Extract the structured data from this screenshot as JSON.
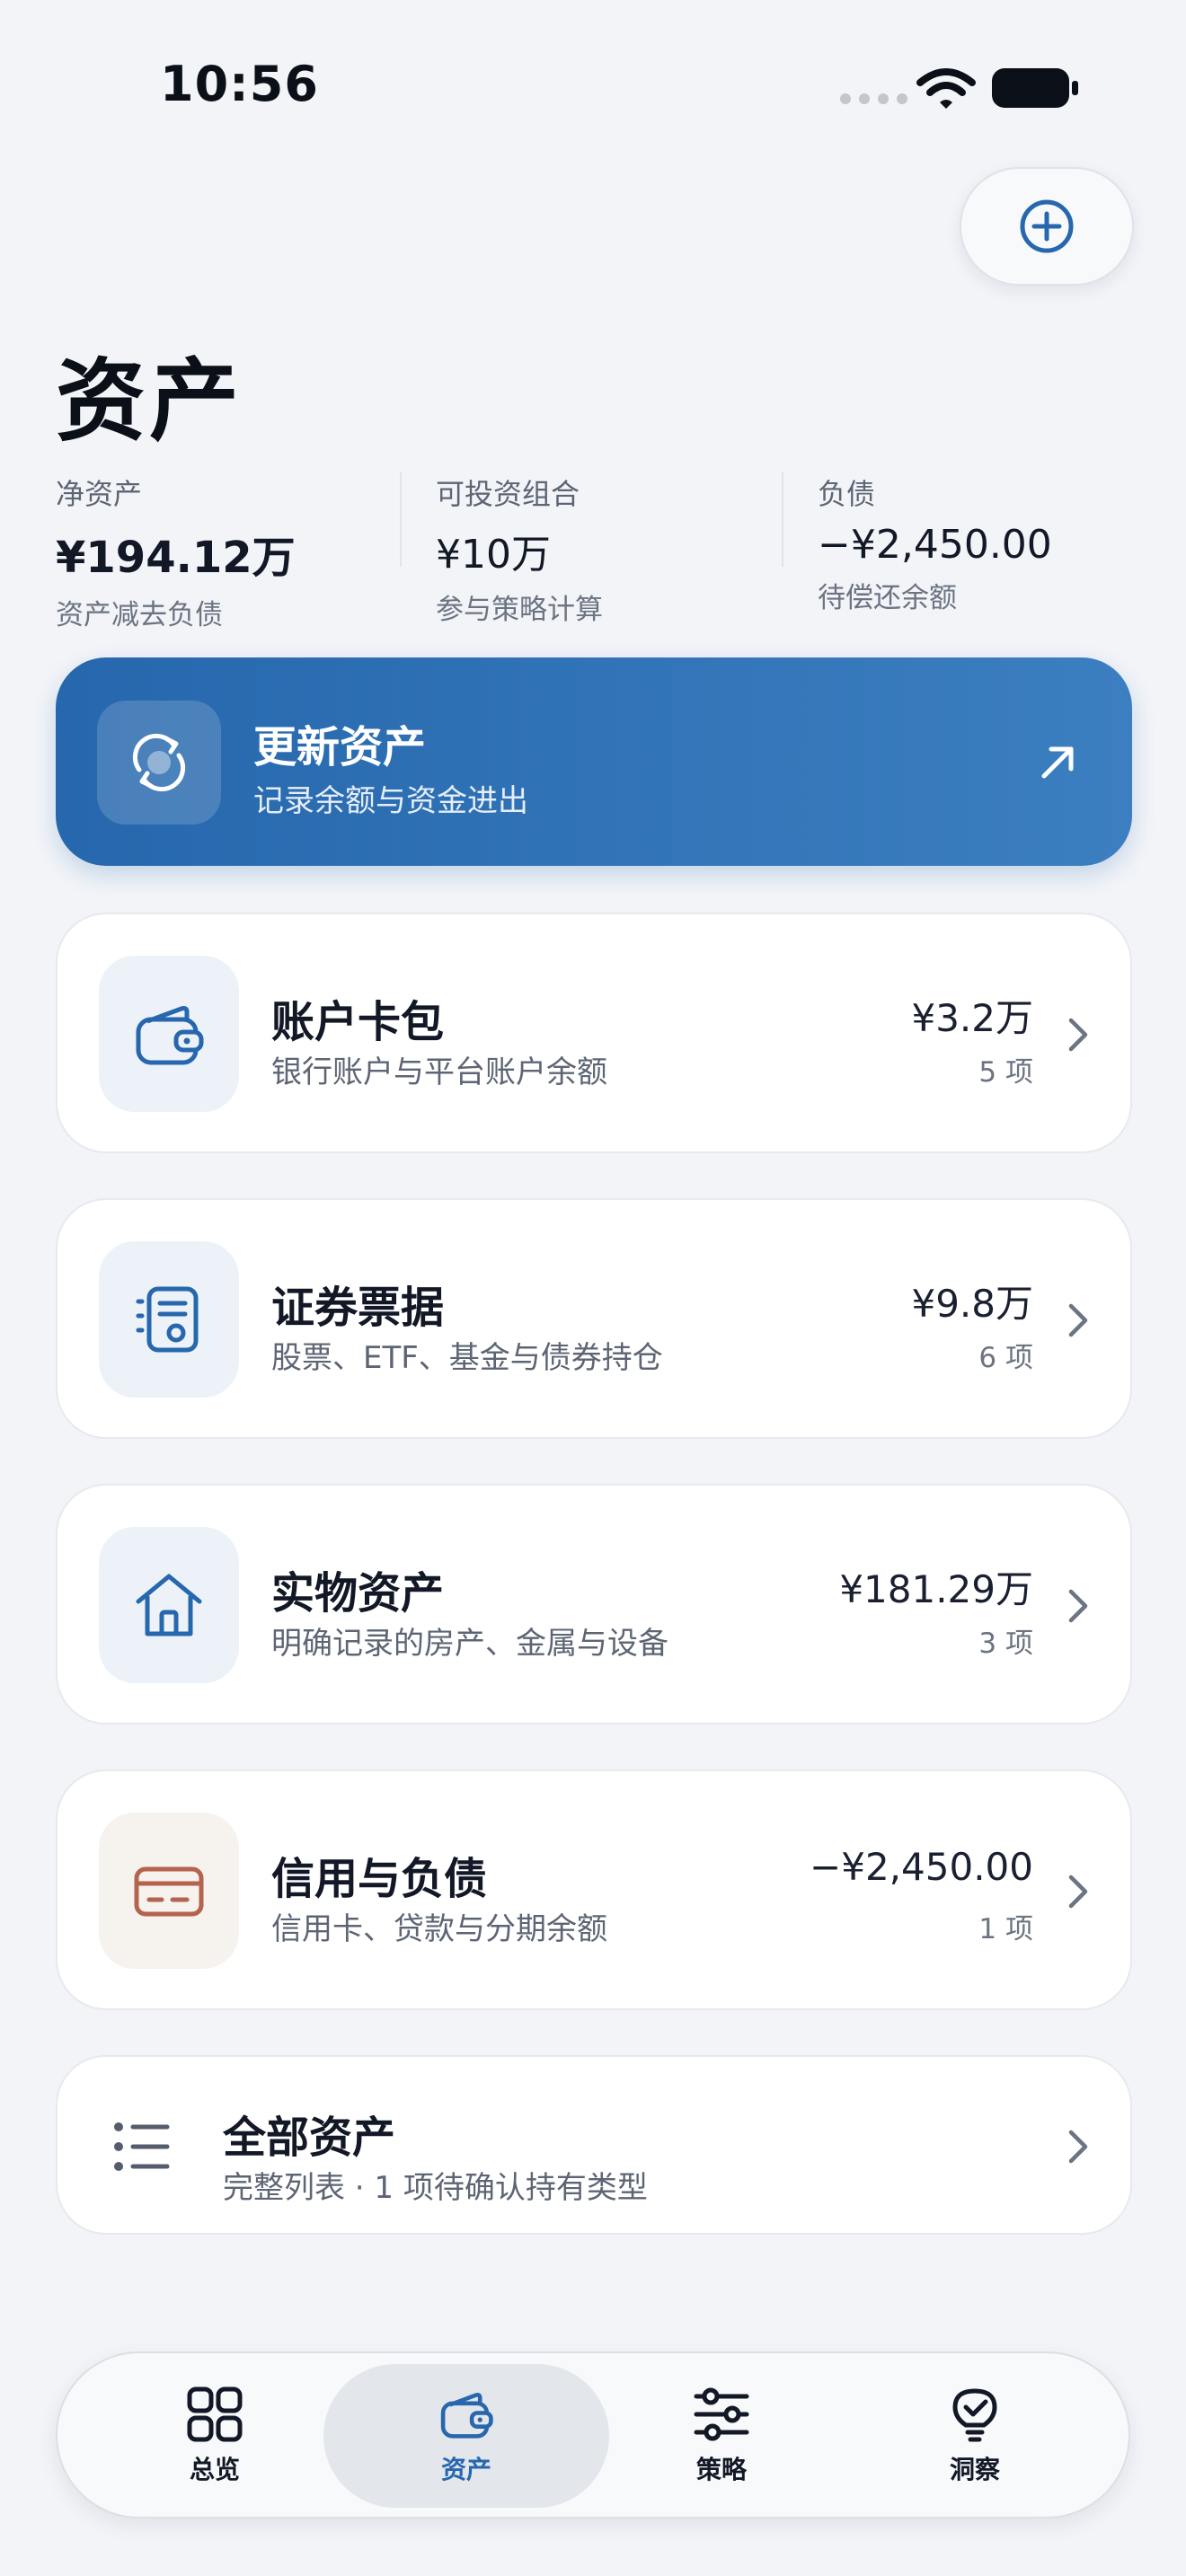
{
  "status": {
    "time": "10:56"
  },
  "page": {
    "title": "资产"
  },
  "summary": {
    "net": {
      "label": "净资产",
      "value": "¥194.12万",
      "sub": "资产减去负债"
    },
    "investable": {
      "label": "可投资组合",
      "value": "¥10万",
      "sub": "参与策略计算"
    },
    "liability": {
      "label": "负债",
      "value": "−¥2,450.00",
      "sub": "待偿还余额"
    }
  },
  "update": {
    "title": "更新资产",
    "subtitle": "记录余额与资金进出"
  },
  "categories": [
    {
      "name": "账户卡包",
      "desc": "银行账户与平台账户余额",
      "amount": "¥3.2万",
      "count": "5 项",
      "icon": "wallet-icon"
    },
    {
      "name": "证券票据",
      "desc": "股票、ETF、基金与债券持仓",
      "amount": "¥9.8万",
      "count": "6 项",
      "icon": "document-icon"
    },
    {
      "name": "实物资产",
      "desc": "明确记录的房产、金属与设备",
      "amount": "¥181.29万",
      "count": "3 项",
      "icon": "house-icon"
    },
    {
      "name": "信用与负债",
      "desc": "信用卡、贷款与分期余额",
      "amount": "−¥2,450.00",
      "count": "1 项",
      "icon": "credit-card-icon"
    }
  ],
  "all_assets": {
    "title": "全部资产",
    "subtitle": "完整列表 · 1 项待确认持有类型"
  },
  "tabs": [
    {
      "label": "总览",
      "icon": "grid-icon"
    },
    {
      "label": "资产",
      "icon": "wallet-icon",
      "active": true
    },
    {
      "label": "策略",
      "icon": "sliders-icon"
    },
    {
      "label": "洞察",
      "icon": "lightbulb-icon"
    }
  ],
  "colors": {
    "accent": "#2667ad",
    "debt": "#b4634e",
    "background": "#f2f4f8"
  }
}
